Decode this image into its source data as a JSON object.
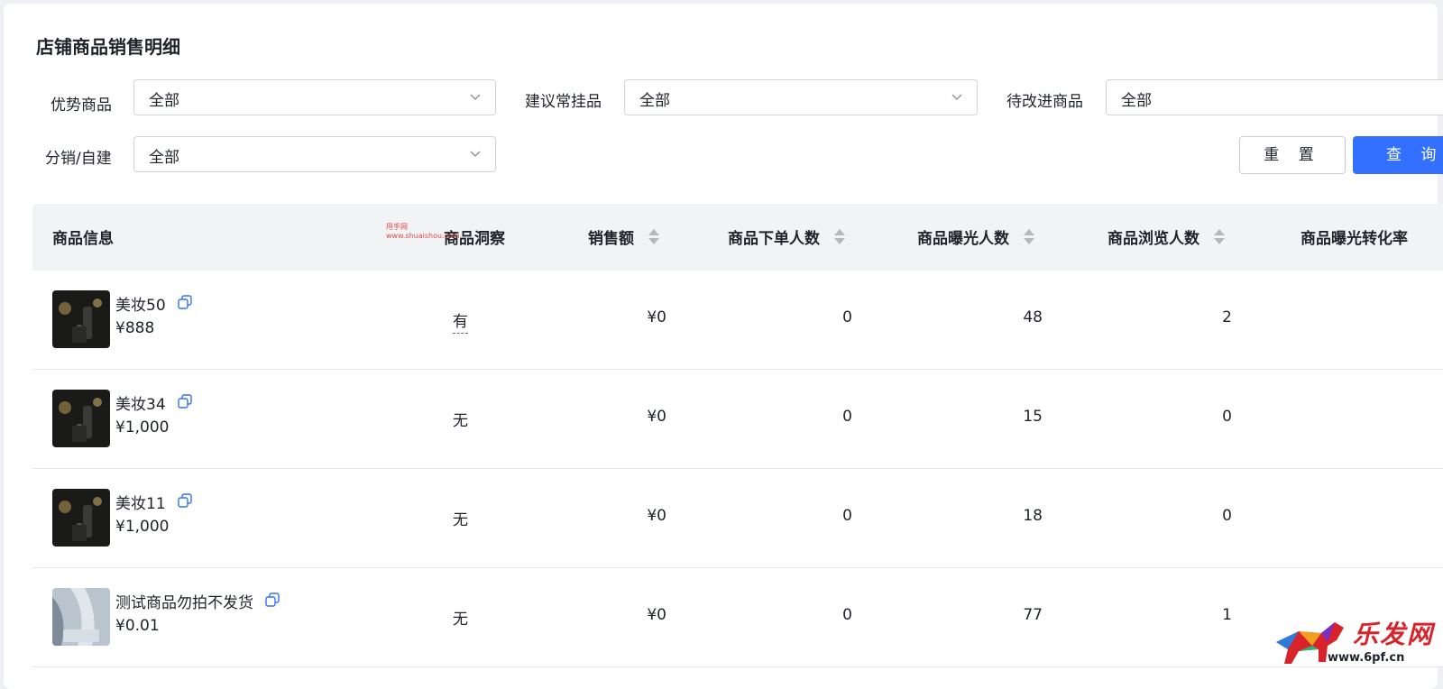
{
  "page": {
    "title": "店铺商品销售明细"
  },
  "filters": {
    "advantage": {
      "label": "优势商品",
      "value": "全部"
    },
    "suggested": {
      "label": "建议常挂品",
      "value": "全部"
    },
    "improve": {
      "label": "待改进商品",
      "value": "全部"
    },
    "distribution": {
      "label": "分销/自建",
      "value": "全部"
    }
  },
  "buttons": {
    "reset": "重 置",
    "query": "查 询"
  },
  "table": {
    "headers": {
      "product": "商品信息",
      "insight": "商品洞察",
      "sales": "销售额",
      "orders": "商品下单人数",
      "exposure": "商品曝光人数",
      "views": "商品浏览人数",
      "conversion": "商品曝光转化率"
    },
    "rows": [
      {
        "name": "美妆50",
        "price": "¥888",
        "insight": "有",
        "sales": "¥0",
        "orders": "0",
        "exposure": "48",
        "views": "2"
      },
      {
        "name": "美妆34",
        "price": "¥1,000",
        "insight": "无",
        "sales": "¥0",
        "orders": "0",
        "exposure": "15",
        "views": "0"
      },
      {
        "name": "美妆11",
        "price": "¥1,000",
        "insight": "无",
        "sales": "¥0",
        "orders": "0",
        "exposure": "18",
        "views": "0"
      },
      {
        "name": "测试商品勿拍不发货",
        "price": "¥0.01",
        "insight": "无",
        "sales": "¥0",
        "orders": "0",
        "exposure": "77",
        "views": "1"
      }
    ]
  },
  "watermark": {
    "line1": "甩手网",
    "line2": "www.shuaishou.com"
  },
  "brand": {
    "name": "乐发网",
    "url": "www.6pf.cn"
  },
  "colors": {
    "primary": "#3370ff",
    "header_bg": "#f2f3f5",
    "border": "#d0d3d6",
    "text": "#1f2329"
  },
  "icons": {
    "select_arrow": "chevron-down-icon",
    "copy": "copy-icon",
    "sort": "sort-icon"
  }
}
